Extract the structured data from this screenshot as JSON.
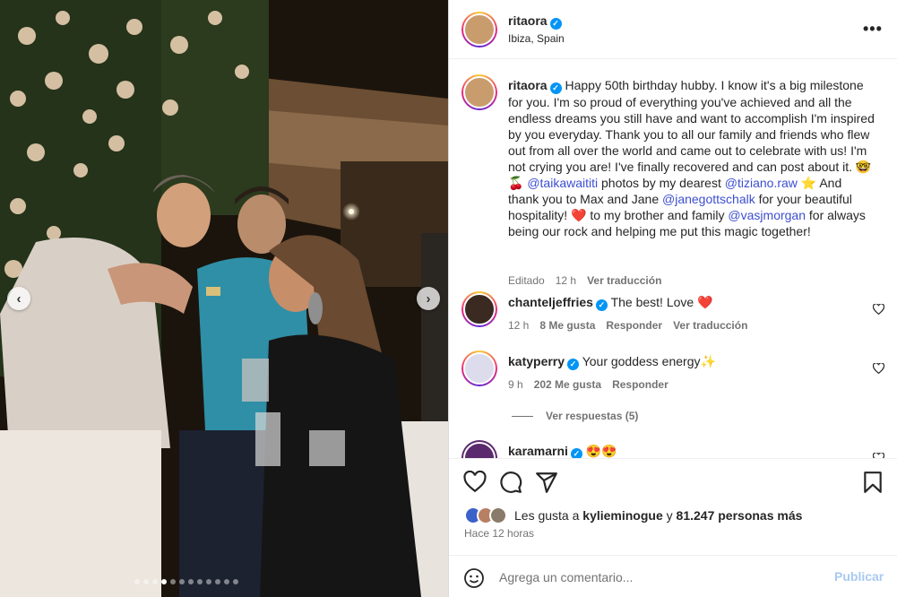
{
  "post": {
    "username": "ritaora",
    "location": "Ibiza, Spain"
  },
  "caption": {
    "username": "ritaora",
    "parts": {
      "p1": "Happy 50th birthday hubby. I know it's a big milestone for you. I'm so proud of everything you've achieved and all the endless dreams you still have and want to accomplish I'm inspired by you everyday. Thank you to all our family and friends who flew out from all over the world and came out to celebrate with us! I'm not crying you are! I've finally recovered and can post about it. 🤓🍒 ",
      "m1": "@taikawaititi",
      "p2": " photos by my dearest ",
      "m2": "@tiziano.raw",
      "p3": " ⭐ And thank you to Max and Jane ",
      "m3": "@janegottschalk",
      "p4": " for your beautiful hospitality! ❤️ to my brother and family ",
      "m4": "@vasjmorgan",
      "p5": " for always being our rock and helping me put this magic together!"
    },
    "edited": "Editado",
    "time": "12 h",
    "translate": "Ver traducción"
  },
  "comments": [
    {
      "username": "chanteljeffries",
      "text": "The best! Love ❤️",
      "time": "12 h",
      "likes": "8 Me gusta",
      "reply": "Responder",
      "translate": "Ver traducción"
    },
    {
      "username": "katyperry",
      "text": "Your goddess energy✨",
      "time": "9 h",
      "likes": "202 Me gusta",
      "reply": "Responder"
    },
    {
      "username": "karamarni",
      "text": "😍😍"
    }
  ],
  "view_replies": "Ver respuestas (5)",
  "likes": {
    "prefix": "Les gusta a",
    "user": "kylieminogue",
    "connector": "y",
    "others": "81.247 personas más"
  },
  "time_ago": "Hace 12 horas",
  "comment_box": {
    "placeholder": "Agrega un comentario...",
    "publish": "Publicar"
  },
  "carousel": {
    "total_slides": 12,
    "current_slide": 4
  },
  "colors": {
    "mention": "#3d4fd1",
    "verified": "#0095f6",
    "publish_disabled": "#a8c9f1",
    "muted": "#737373"
  },
  "icons": [
    "more-options-icon",
    "verified-badge-icon",
    "heart-icon",
    "comment-icon",
    "share-icon",
    "bookmark-icon",
    "emoji-icon",
    "chevron-left-icon",
    "chevron-right-icon"
  ]
}
